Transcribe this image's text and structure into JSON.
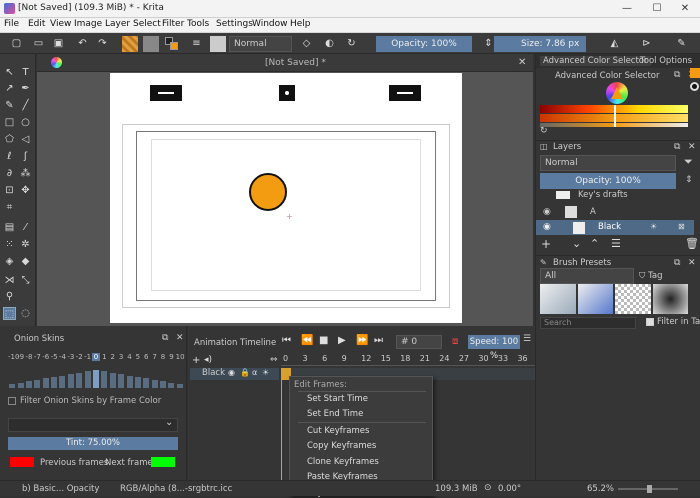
{
  "window": {
    "title": "[Not Saved]  (109.3 MiB)  * - Krita",
    "controls": [
      "—",
      "☐",
      "✕"
    ]
  },
  "menu": [
    "File",
    "Edit",
    "View",
    "Image",
    "Layer",
    "Select",
    "Filter",
    "Tools",
    "Settings",
    "Window",
    "Help"
  ],
  "toolbar": {
    "blend_mode": "Normal",
    "opacity": "Opacity: 100%",
    "size": "Size: 7.86 px"
  },
  "document": {
    "tab_title": "[Not Saved]  *",
    "circle_color": "#f39c12"
  },
  "color_selector": {
    "tabs": [
      "Advanced Color Selector",
      "Tool Options"
    ],
    "title": "Advanced Color Selector"
  },
  "layers": {
    "title": "Layers",
    "blend_mode": "Normal",
    "opacity": "Opacity:  100%",
    "items": [
      "Key's drafts",
      "A",
      "Black"
    ]
  },
  "brush_presets": {
    "title": "Brush Presets",
    "filter": "All",
    "tag_label": "Tag",
    "search_placeholder": "Search",
    "filter_in_tag": "Filter in Tag"
  },
  "onion": {
    "title": "Onion Skins",
    "numbers": [
      "-10",
      "-9",
      "-8",
      "-7",
      "-6",
      "-5",
      "-4",
      "-3",
      "-2",
      "-1",
      "0",
      "1",
      "2",
      "3",
      "4",
      "5",
      "6",
      "7",
      "8",
      "9",
      "10"
    ],
    "filter_label": "Filter Onion Skins by Frame Color",
    "tint": "Tint: 75.00%",
    "previous": "Previous frames",
    "next": "Next frames",
    "prev_color": "#ff0000",
    "next_color": "#00ff00"
  },
  "timeline": {
    "title": "Animation Timeline",
    "frame": "# 0",
    "speed": "Speed: 100 %",
    "ruler": [
      "0",
      "3",
      "6",
      "9",
      "12",
      "15",
      "18",
      "21",
      "24",
      "27",
      "30",
      "33",
      "36"
    ],
    "layer": "Black"
  },
  "context_menu": {
    "header": "Edit Frames:",
    "items": [
      "Set Start Time",
      "Set End Time",
      "Cut Keyframes",
      "Copy Keyframes",
      "Clone Keyframes",
      "Paste Keyframes",
      "Keyframes"
    ]
  },
  "status": {
    "brush": "b) Basic... Opacity",
    "color": "RGB/Alpha (8...-srgbtrc.icc",
    "size": "109.3 MiB",
    "time": "0.00°",
    "zoom": "65.2%"
  }
}
